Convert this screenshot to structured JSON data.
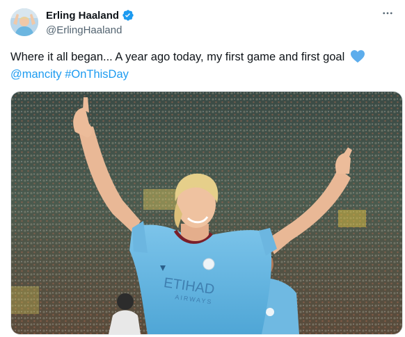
{
  "tweet": {
    "author": {
      "display_name": "Erling Haaland",
      "handle": "@ErlingHaaland",
      "verified": true,
      "verified_color": "#1d9bf0"
    },
    "more_icon": "more-horizontal-icon",
    "text": {
      "body": "Where it all began... A year ago today, my first game and first goal",
      "emoji": "blue-heart",
      "mention": "@mancity",
      "hashtag": "#OnThisDay",
      "link_color": "#1d9bf0"
    },
    "media": {
      "type": "photo",
      "subject": "player-celebrating",
      "shirt_sponsor": "ETIHAD",
      "shirt_sponsor_sub": "AIRWAYS",
      "kit_color": "#6cb6e0"
    }
  }
}
